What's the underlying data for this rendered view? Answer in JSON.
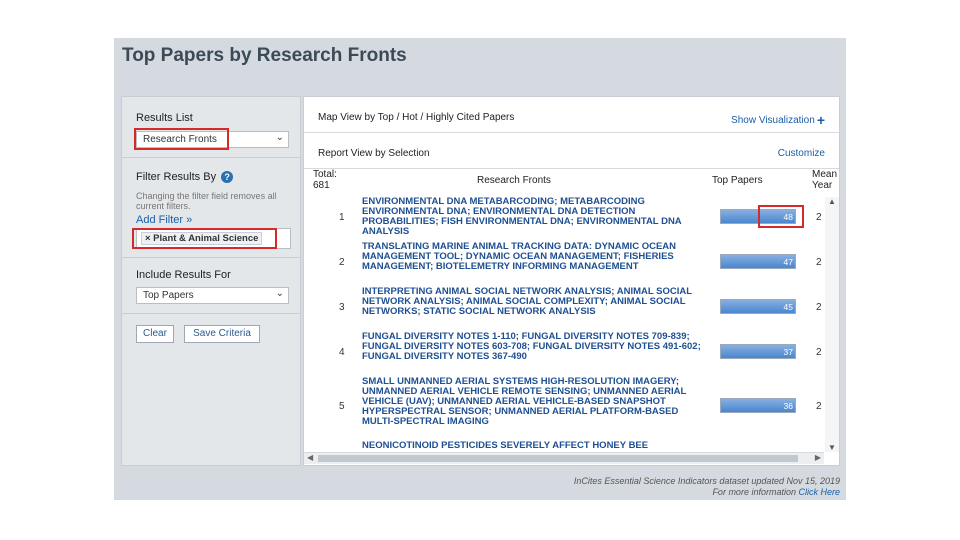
{
  "page": {
    "title": "Top Papers by Research Fronts"
  },
  "sidebar": {
    "results_list_label": "Results List",
    "results_list_value": "Research Fronts",
    "filter_label": "Filter Results By",
    "filter_note": "Changing the filter field removes all current filters.",
    "add_filter": "Add Filter »",
    "filter_chip": "× Plant & Animal Science",
    "include_label": "Include Results For",
    "include_value": "Top Papers",
    "clear_label": "Clear",
    "save_label": "Save Criteria",
    "chevron_glyph": "⌄"
  },
  "main": {
    "map_view_label": "Map View by Top / Hot / Highly Cited Papers",
    "show_visualization_label": "Show Visualization",
    "report_view_label": "Report View by Selection",
    "customize_label": "Customize",
    "table": {
      "total_label": "Total:",
      "total_value": "681",
      "col_front": "Research Fronts",
      "col_top": "Top Papers",
      "col_year_1": "Mean",
      "col_year_2": "Year",
      "rows": [
        {
          "rank": "1",
          "front": "ENVIRONMENTAL DNA METABARCODING; METABARCODING ENVIRONMENTAL DNA; ENVIRONMENTAL DNA DETECTION PROBABILITIES; FISH ENVIRONMENTAL DNA; ENVIRONMENTAL DNA ANALYSIS",
          "top": "48",
          "year": "2"
        },
        {
          "rank": "2",
          "front": "TRANSLATING MARINE ANIMAL TRACKING DATA: DYNAMIC OCEAN MANAGEMENT TOOL; DYNAMIC OCEAN MANAGEMENT; FISHERIES MANAGEMENT; BIOTELEMETRY INFORMING MANAGEMENT",
          "top": "47",
          "year": "2"
        },
        {
          "rank": "3",
          "front": "INTERPRETING ANIMAL SOCIAL NETWORK ANALYSIS; ANIMAL SOCIAL NETWORK ANALYSIS; ANIMAL SOCIAL COMPLEXITY; ANIMAL SOCIAL NETWORKS; STATIC SOCIAL NETWORK ANALYSIS",
          "top": "45",
          "year": "2"
        },
        {
          "rank": "4",
          "front": "FUNGAL DIVERSITY NOTES 1-110; FUNGAL DIVERSITY NOTES 709-839; FUNGAL DIVERSITY NOTES 603-708; FUNGAL DIVERSITY NOTES 491-602; FUNGAL DIVERSITY NOTES 367-490",
          "top": "37",
          "year": "2"
        },
        {
          "rank": "5",
          "front": "SMALL UNMANNED AERIAL SYSTEMS HIGH-RESOLUTION IMAGERY; UNMANNED AERIAL VEHICLE REMOTE SENSING; UNMANNED AERIAL VEHICLE (UAV); UNMANNED AERIAL VEHICLE-BASED SNAPSHOT HYPERSPECTRAL SENSOR; UNMANNED AERIAL PLATFORM-BASED MULTI-SPECTRAL IMAGING",
          "top": "36",
          "year": "2"
        },
        {
          "rank": "",
          "front": "NEONICOTINOID PESTICIDES SEVERELY AFFECT HONEY BEE",
          "top": "",
          "year": ""
        }
      ]
    }
  },
  "footer": {
    "line1": "InCites Essential Science Indicators dataset updated Nov 15, 2019",
    "line2_prefix": "For more information",
    "line2_link": "Click Here"
  }
}
